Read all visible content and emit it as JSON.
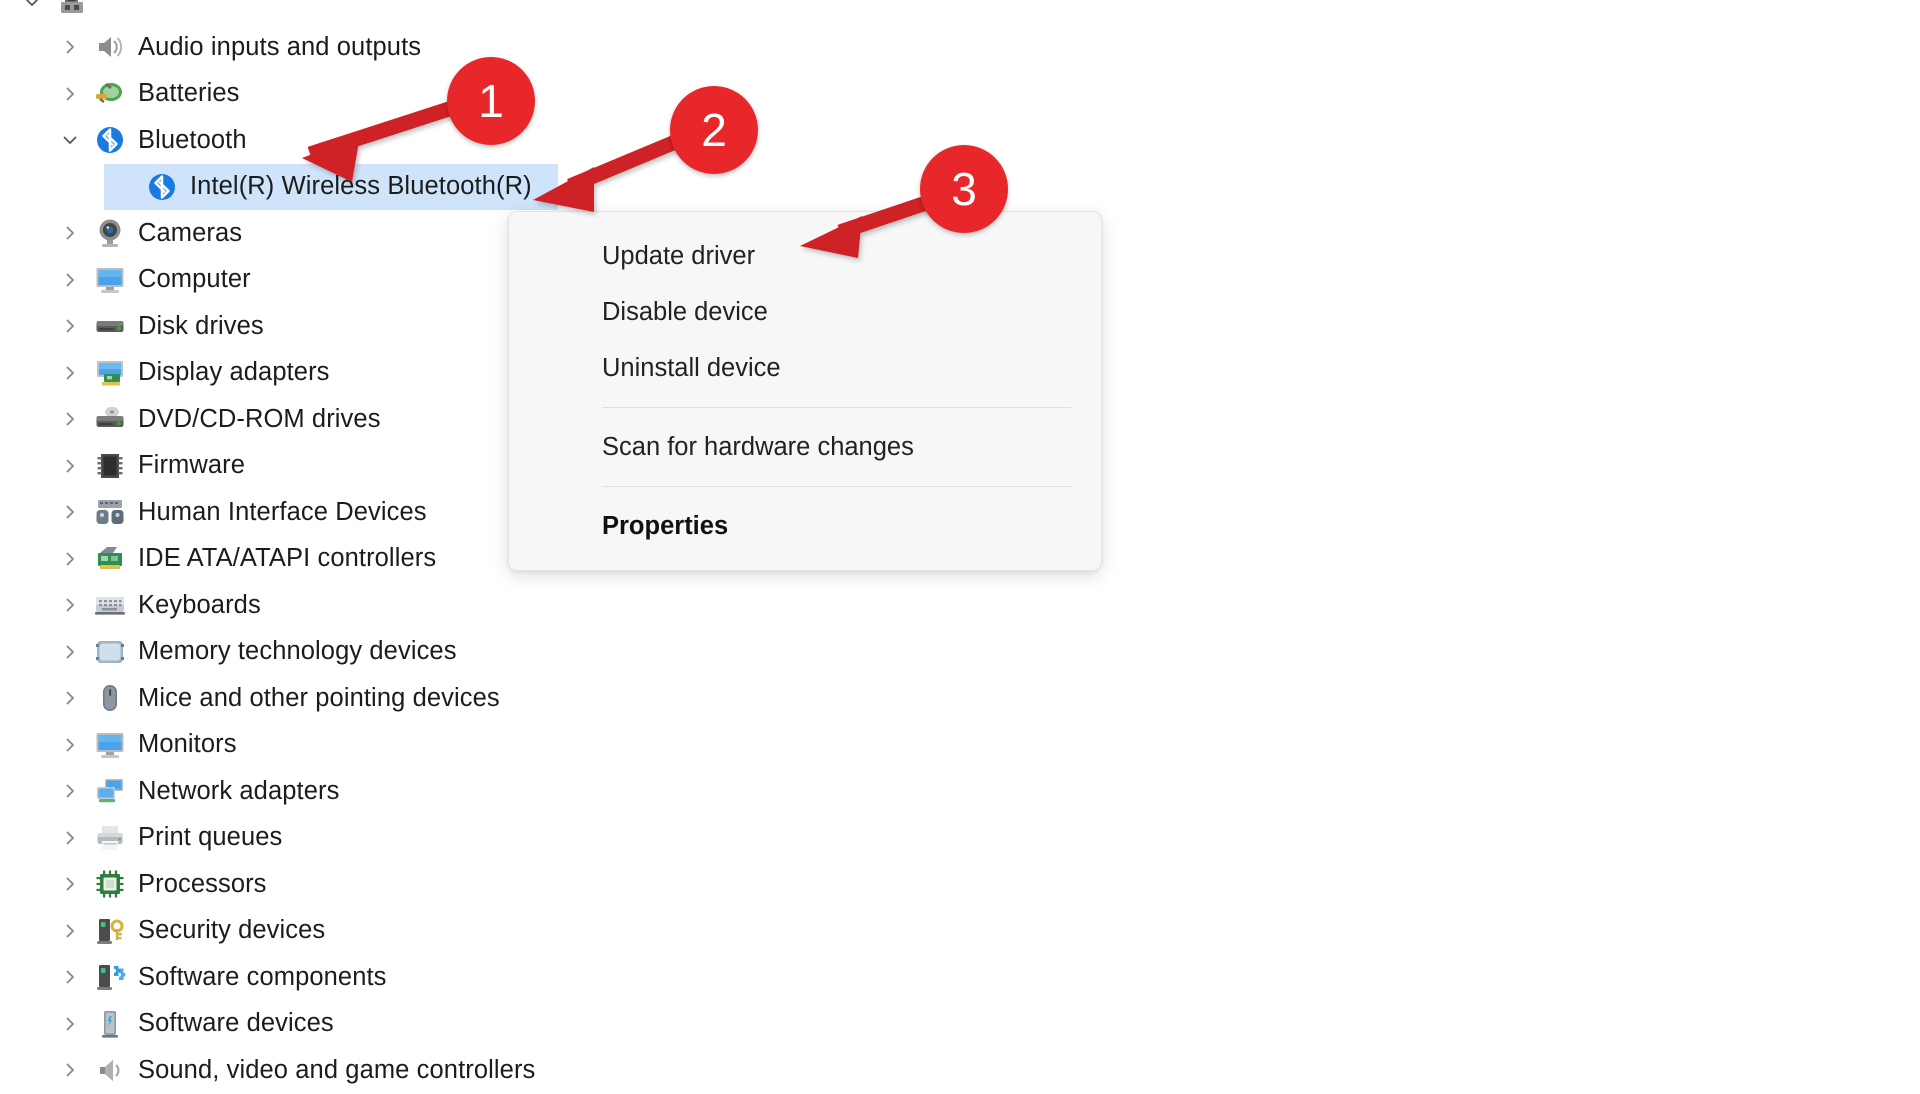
{
  "window": {
    "app": "Device Manager",
    "background_color": "#ffffff"
  },
  "tree": {
    "root": {
      "label": "",
      "icon": "computer-root-icon",
      "expanded": true
    },
    "items": [
      {
        "label": "Audio inputs and outputs",
        "icon": "speaker-icon",
        "depth": 1,
        "expanded": false,
        "selected": false
      },
      {
        "label": "Batteries",
        "icon": "battery-icon",
        "depth": 1,
        "expanded": false,
        "selected": false
      },
      {
        "label": "Bluetooth",
        "icon": "bluetooth-icon",
        "depth": 1,
        "expanded": true,
        "selected": false
      },
      {
        "label": "Intel(R) Wireless Bluetooth(R)",
        "icon": "bluetooth-icon",
        "depth": 2,
        "expanded": null,
        "selected": true
      },
      {
        "label": "Cameras",
        "icon": "camera-icon",
        "depth": 1,
        "expanded": false,
        "selected": false
      },
      {
        "label": "Computer",
        "icon": "monitor-icon",
        "depth": 1,
        "expanded": false,
        "selected": false
      },
      {
        "label": "Disk drives",
        "icon": "disk-drive-icon",
        "depth": 1,
        "expanded": false,
        "selected": false
      },
      {
        "label": "Display adapters",
        "icon": "display-adapter-icon",
        "depth": 1,
        "expanded": false,
        "selected": false
      },
      {
        "label": "DVD/CD-ROM drives",
        "icon": "dvd-drive-icon",
        "depth": 1,
        "expanded": false,
        "selected": false
      },
      {
        "label": "Firmware",
        "icon": "firmware-chip-icon",
        "depth": 1,
        "expanded": false,
        "selected": false
      },
      {
        "label": "Human Interface Devices",
        "icon": "hid-icon",
        "depth": 1,
        "expanded": false,
        "selected": false
      },
      {
        "label": "IDE ATA/ATAPI controllers",
        "icon": "ide-controller-icon",
        "depth": 1,
        "expanded": false,
        "selected": false
      },
      {
        "label": "Keyboards",
        "icon": "keyboard-icon",
        "depth": 1,
        "expanded": false,
        "selected": false
      },
      {
        "label": "Memory technology devices",
        "icon": "memory-device-icon",
        "depth": 1,
        "expanded": false,
        "selected": false
      },
      {
        "label": "Mice and other pointing devices",
        "icon": "mouse-icon",
        "depth": 1,
        "expanded": false,
        "selected": false
      },
      {
        "label": "Monitors",
        "icon": "monitor-icon",
        "depth": 1,
        "expanded": false,
        "selected": false
      },
      {
        "label": "Network adapters",
        "icon": "network-adapter-icon",
        "depth": 1,
        "expanded": false,
        "selected": false
      },
      {
        "label": "Print queues",
        "icon": "printer-icon",
        "depth": 1,
        "expanded": false,
        "selected": false
      },
      {
        "label": "Processors",
        "icon": "processor-icon",
        "depth": 1,
        "expanded": false,
        "selected": false
      },
      {
        "label": "Security devices",
        "icon": "security-device-icon",
        "depth": 1,
        "expanded": false,
        "selected": false
      },
      {
        "label": "Software components",
        "icon": "software-component-icon",
        "depth": 1,
        "expanded": false,
        "selected": false
      },
      {
        "label": "Software devices",
        "icon": "software-device-icon",
        "depth": 1,
        "expanded": false,
        "selected": false
      },
      {
        "label": "Sound, video and game controllers",
        "icon": "sound-device-icon",
        "depth": 1,
        "expanded": false,
        "selected": false
      }
    ]
  },
  "context_menu": {
    "items": [
      {
        "label": "Update driver",
        "bold": false,
        "separator_after": false
      },
      {
        "label": "Disable device",
        "bold": false,
        "separator_after": false
      },
      {
        "label": "Uninstall device",
        "bold": false,
        "separator_after": true
      },
      {
        "label": "Scan for hardware changes",
        "bold": false,
        "separator_after": true
      },
      {
        "label": "Properties",
        "bold": true,
        "separator_after": false
      }
    ]
  },
  "annotations": {
    "color": "#e8272a",
    "badges": [
      {
        "number": "1",
        "target": "Bluetooth"
      },
      {
        "number": "2",
        "target": "Intel(R) Wireless Bluetooth(R)"
      },
      {
        "number": "3",
        "target": "Update driver"
      }
    ]
  },
  "colors": {
    "selection": "#cfe4fa",
    "menu_background": "#f7f7f7",
    "annotation_red": "#e8272a",
    "text": "#1c1c1c"
  }
}
